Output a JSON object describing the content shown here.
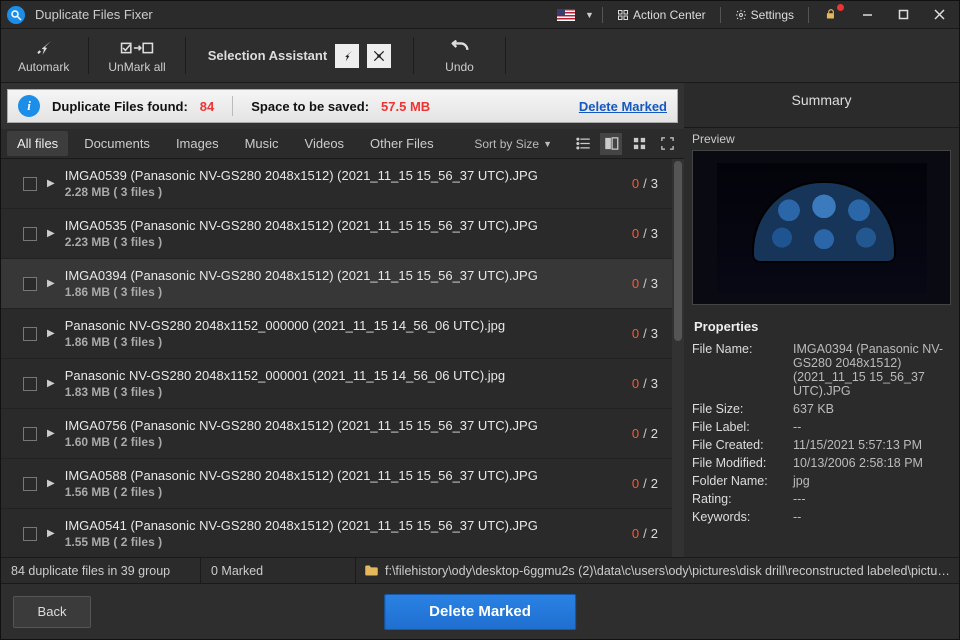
{
  "titlebar": {
    "title": "Duplicate Files Fixer",
    "action_center": "Action Center",
    "settings": "Settings"
  },
  "toolbar": {
    "automark": "Automark",
    "unmark_all": "UnMark all",
    "selection_assistant": "Selection Assistant",
    "undo": "Undo"
  },
  "banner": {
    "found_label": "Duplicate Files found:",
    "found_count": "84",
    "space_label": "Space to be saved:",
    "space_value": "57.5 MB",
    "delete_marked": "Delete Marked"
  },
  "tabs": {
    "items": [
      "All files",
      "Documents",
      "Images",
      "Music",
      "Videos",
      "Other Files"
    ],
    "active": 0,
    "sort": "Sort by Size"
  },
  "groups": [
    {
      "name": "IMGA0539 (Panasonic NV-GS280 2048x1512) (2021_11_15 15_56_37 UTC).JPG",
      "meta": "2.28 MB  ( 3 files )",
      "marked": 0,
      "total": 3,
      "selected": false
    },
    {
      "name": "IMGA0535 (Panasonic NV-GS280 2048x1512) (2021_11_15 15_56_37 UTC).JPG",
      "meta": "2.23 MB  ( 3 files )",
      "marked": 0,
      "total": 3,
      "selected": false
    },
    {
      "name": "IMGA0394 (Panasonic NV-GS280 2048x1512) (2021_11_15 15_56_37 UTC).JPG",
      "meta": "1.86 MB  ( 3 files )",
      "marked": 0,
      "total": 3,
      "selected": true
    },
    {
      "name": "Panasonic NV-GS280 2048x1152_000000 (2021_11_15 14_56_06 UTC).jpg",
      "meta": "1.86 MB  ( 3 files )",
      "marked": 0,
      "total": 3,
      "selected": false
    },
    {
      "name": "Panasonic NV-GS280 2048x1152_000001 (2021_11_15 14_56_06 UTC).jpg",
      "meta": "1.83 MB  ( 3 files )",
      "marked": 0,
      "total": 3,
      "selected": false
    },
    {
      "name": "IMGA0756 (Panasonic NV-GS280 2048x1512) (2021_11_15 15_56_37 UTC).JPG",
      "meta": "1.60 MB  ( 2 files )",
      "marked": 0,
      "total": 2,
      "selected": false
    },
    {
      "name": "IMGA0588 (Panasonic NV-GS280 2048x1512) (2021_11_15 15_56_37 UTC).JPG",
      "meta": "1.56 MB  ( 2 files )",
      "marked": 0,
      "total": 2,
      "selected": false
    },
    {
      "name": "IMGA0541 (Panasonic NV-GS280 2048x1512) (2021_11_15 15_56_37 UTC).JPG",
      "meta": "1.55 MB  ( 2 files )",
      "marked": 0,
      "total": 2,
      "selected": false
    }
  ],
  "summary": {
    "heading": "Summary",
    "preview": "Preview",
    "props_heading": "Properties"
  },
  "properties": [
    {
      "k": "File Name:",
      "v": "IMGA0394 (Panasonic NV-GS280 2048x1512) (2021_11_15 15_56_37 UTC).JPG"
    },
    {
      "k": "File Size:",
      "v": "637 KB"
    },
    {
      "k": "File Label:",
      "v": "--"
    },
    {
      "k": "File Created:",
      "v": "11/15/2021 5:57:13 PM"
    },
    {
      "k": "File Modified:",
      "v": "10/13/2006 2:58:18 PM"
    },
    {
      "k": "Folder Name:",
      "v": "jpg"
    },
    {
      "k": "Rating:",
      "v": "---"
    },
    {
      "k": "Keywords:",
      "v": "--"
    }
  ],
  "status": {
    "summary": "84 duplicate files in 39 group",
    "marked": "0 Marked",
    "path": "f:\\filehistory\\ody\\desktop-6ggmu2s (2)\\data\\c\\users\\ody\\pictures\\disk drill\\reconstructed labeled\\pictur..."
  },
  "bottom": {
    "back": "Back",
    "delete": "Delete Marked"
  }
}
